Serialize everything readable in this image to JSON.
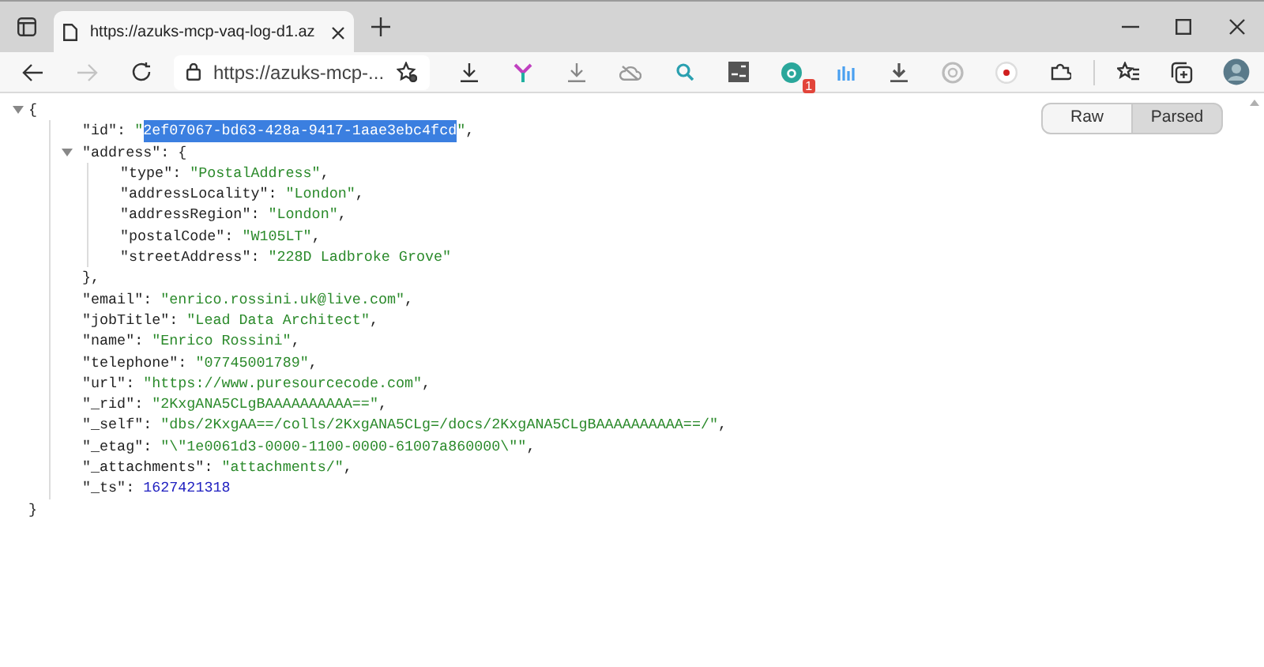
{
  "browser": {
    "tab": {
      "title": "https://azuks-mcp-vaq-log-d1.az"
    },
    "forward": {
      "disabled": true
    },
    "address_bar": {
      "url": "https://azuks-mcp-..."
    },
    "extension_badge": "1"
  },
  "view_modes": [
    {
      "label": "Raw",
      "selected": false
    },
    {
      "label": "Parsed",
      "selected": true
    }
  ],
  "document": {
    "open": "{",
    "expanded": true,
    "close": "}",
    "children": [
      {
        "kind": "string",
        "key": "\"id\"",
        "colon": ":",
        "value_open": "\"",
        "value": "2ef07067-bd63-428a-9417-1aae3ebc4fcd",
        "value_close": "\"",
        "selected": true,
        "comma": ","
      },
      {
        "kind": "object",
        "key": "\"address\"",
        "colon": ":",
        "open": "{",
        "expanded": true,
        "close": "}",
        "comma": ",",
        "children": [
          {
            "kind": "string",
            "key": "\"type\"",
            "colon": ":",
            "value": "\"PostalAddress\"",
            "comma": ","
          },
          {
            "kind": "string",
            "key": "\"addressLocality\"",
            "colon": ":",
            "value": "\"London\"",
            "comma": ","
          },
          {
            "kind": "string",
            "key": "\"addressRegion\"",
            "colon": ":",
            "value": "\"London\"",
            "comma": ","
          },
          {
            "kind": "string",
            "key": "\"postalCode\"",
            "colon": ":",
            "value": "\"W105LT\"",
            "comma": ","
          },
          {
            "kind": "string",
            "key": "\"streetAddress\"",
            "colon": ":",
            "value": "\"228D Ladbroke Grove\""
          }
        ]
      },
      {
        "kind": "string",
        "key": "\"email\"",
        "colon": ":",
        "value": "\"enrico.rossini.uk@live.com\"",
        "comma": ","
      },
      {
        "kind": "string",
        "key": "\"jobTitle\"",
        "colon": ":",
        "value": "\"Lead Data Architect\"",
        "comma": ","
      },
      {
        "kind": "string",
        "key": "\"name\"",
        "colon": ":",
        "value": "\"Enrico Rossini\"",
        "comma": ","
      },
      {
        "kind": "string",
        "key": "\"telephone\"",
        "colon": ":",
        "value": "\"07745001789\"",
        "comma": ","
      },
      {
        "kind": "string",
        "key": "\"url\"",
        "colon": ":",
        "value": "\"https://www.puresourcecode.com\"",
        "comma": ","
      },
      {
        "kind": "string",
        "key": "\"_rid\"",
        "colon": ":",
        "value": "\"2KxgANA5CLgBAAAAAAAAAA==\"",
        "comma": ","
      },
      {
        "kind": "string",
        "key": "\"_self\"",
        "colon": ":",
        "value": "\"dbs/2KxgAA==/colls/2KxgANA5CLg=/docs/2KxgANA5CLgBAAAAAAAAAA==/\"",
        "comma": ","
      },
      {
        "kind": "string",
        "key": "\"_etag\"",
        "colon": ":",
        "value": "\"\\\"1e0061d3-0000-1100-0000-61007a860000\\\"\"",
        "comma": ","
      },
      {
        "kind": "string",
        "key": "\"_attachments\"",
        "colon": ":",
        "value": "\"attachments/\"",
        "comma": ","
      },
      {
        "kind": "number",
        "key": "\"_ts\"",
        "colon": ":",
        "value": "1627421318"
      }
    ]
  }
}
